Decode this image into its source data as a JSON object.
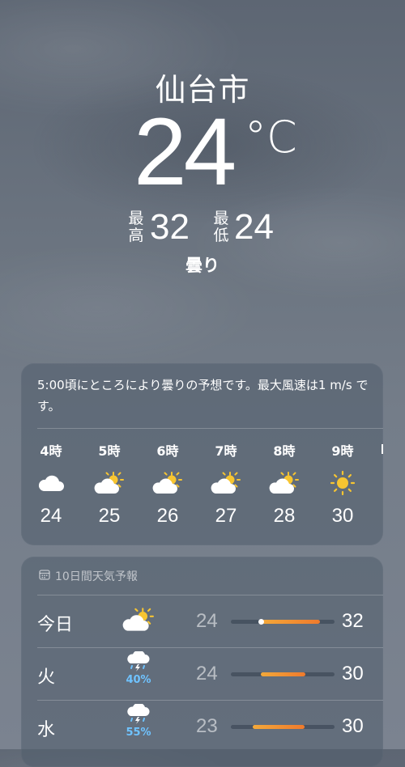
{
  "location": {
    "city": "仙台市"
  },
  "current": {
    "temp": "24",
    "unit": "°C",
    "high_label": "最高",
    "high": "32",
    "low_label": "最低",
    "low": "24",
    "condition": "曇り"
  },
  "hourly": {
    "summary": "5:00頃にところにより曇りの予想です。最大風速は1 m/s です。",
    "hours": [
      {
        "label": "4時",
        "icon": "cloud-icon",
        "temp": "24"
      },
      {
        "label": "5時",
        "icon": "partly-sunny-icon",
        "temp": "25"
      },
      {
        "label": "6時",
        "icon": "partly-sunny-icon",
        "temp": "26"
      },
      {
        "label": "7時",
        "icon": "partly-sunny-icon",
        "temp": "27"
      },
      {
        "label": "8時",
        "icon": "partly-sunny-icon",
        "temp": "28"
      },
      {
        "label": "9時",
        "icon": "sun-icon",
        "temp": "30"
      }
    ]
  },
  "daily": {
    "title": "10日間天気予報",
    "range": {
      "min": 20,
      "max": 34
    },
    "days": [
      {
        "day": "今日",
        "icon": "partly-sunny-icon",
        "pop": "",
        "low": "24",
        "high": "32",
        "current": 24
      },
      {
        "day": "火",
        "icon": "thunderstorm-icon",
        "pop": "40%",
        "low": "24",
        "high": "30"
      },
      {
        "day": "水",
        "icon": "thunderstorm-icon",
        "pop": "55%",
        "low": "23",
        "high": "30"
      }
    ]
  },
  "colors": {
    "temp_bar_start": "#f3a93a",
    "temp_bar_end": "#ef7a2c",
    "precip": "#6fc3ff",
    "sun": "#f7c531"
  }
}
